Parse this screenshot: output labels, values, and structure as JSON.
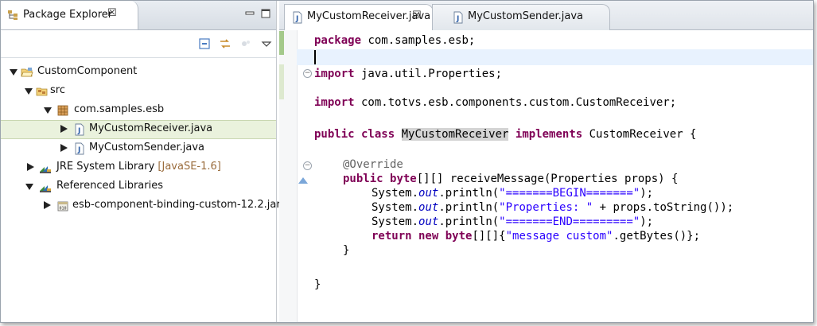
{
  "package_explorer": {
    "tab_label": "Package Explorer",
    "tab_close": "☒",
    "tree": [
      {
        "label": "CustomComponent",
        "state": "open",
        "icon": "project-folder-icon"
      },
      {
        "label": "src",
        "state": "open",
        "icon": "source-folder-icon"
      },
      {
        "label": "com.samples.esb",
        "state": "open",
        "icon": "package-icon"
      },
      {
        "label": "MyCustomReceiver.java",
        "state": "closed",
        "icon": "java-file-icon",
        "selected": true
      },
      {
        "label": "MyCustomSender.java",
        "state": "closed",
        "icon": "java-file-icon"
      },
      {
        "label": "JRE System Library",
        "decoration": "[JavaSE-1.6]",
        "state": "closed",
        "icon": "library-icon"
      },
      {
        "label": "Referenced Libraries",
        "state": "open",
        "icon": "library-icon"
      },
      {
        "label": "esb-component-binding-custom-12.2.jar",
        "state": "closed",
        "icon": "jar-icon"
      }
    ]
  },
  "editor": {
    "tabs": [
      {
        "label": "MyCustomReceiver.java",
        "close": "☒",
        "active": true
      },
      {
        "label": "MyCustomSender.java",
        "active": false
      }
    ],
    "code": {
      "l1_kw": "package",
      "l1_rest": " com.samples.esb;",
      "l3_kw": "import",
      "l3_rest": " java.util.Properties;",
      "l5_kw": "import",
      "l5_rest": " com.totvs.esb.components.custom.CustomReceiver;",
      "l7_kw1": "public class",
      "l7_cls": "MyCustomReceiver",
      "l7_kw2": "implements",
      "l7_rest": " CustomReceiver {",
      "l9_ann": "@Override",
      "l10_kw1": "public",
      "l10_kw2": "byte",
      "l10_rest": "[][] receiveMessage(Properties props) {",
      "sys": "System.",
      "out": "out",
      "println": ".println(",
      "l11_str": "\"=======BEGIN=======\"",
      "l12_str": "\"Properties: \"",
      "l12_rest": " + props.toString());",
      "l13_str": "\"=======END=========\"",
      "close_paren": ");",
      "l14_kw1": "return new",
      "l14_kw2": "byte",
      "l14_mid": "[][]{",
      "l14_str": "\"message custom\"",
      "l14_rest": ".getBytes()};",
      "l15": "}",
      "l17": "}"
    }
  },
  "colors": {
    "keyword": "#7f0055",
    "string": "#2a00ff",
    "annotation": "#646464",
    "static_field": "#0000c0",
    "selection": "#eaf2dd"
  }
}
